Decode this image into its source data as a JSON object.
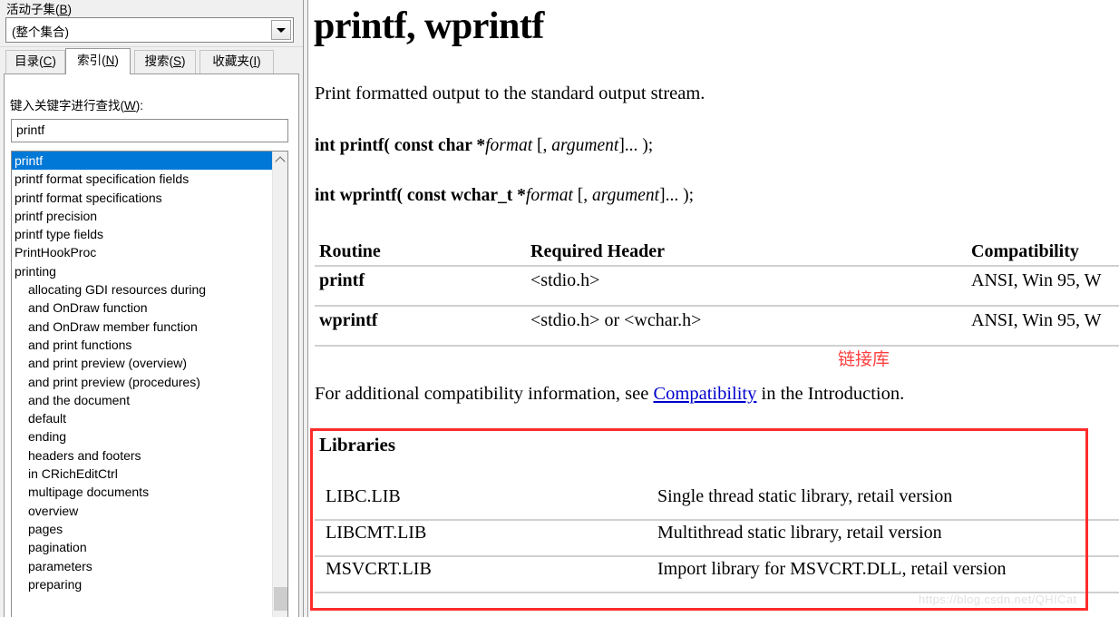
{
  "nav": {
    "subset": {
      "label": "活动子集(B)",
      "label_accel": "B",
      "value": "(整个集合)",
      "dropdown_icon": "chevron-down-icon"
    },
    "tabs": [
      {
        "label": "目录(C)",
        "accel": "C",
        "active": false
      },
      {
        "label": "索引(N)",
        "accel": "N",
        "active": true
      },
      {
        "label": "搜索(S)",
        "accel": "S",
        "active": false
      },
      {
        "label": "收藏夹(I)",
        "accel": "I",
        "active": false
      }
    ],
    "index": {
      "hint": "键入关键字进行查找(W):",
      "hint_accel": "W",
      "keyword_value": "printf",
      "keyword_placeholder": "",
      "selected_index": 0,
      "items": [
        {
          "label": "printf",
          "indent": false
        },
        {
          "label": "printf format specification fields",
          "indent": false
        },
        {
          "label": "printf format specifications",
          "indent": false
        },
        {
          "label": "printf precision",
          "indent": false
        },
        {
          "label": "printf type fields",
          "indent": false
        },
        {
          "label": "PrintHookProc",
          "indent": false
        },
        {
          "label": "printing",
          "indent": false
        },
        {
          "label": "allocating GDI resources during",
          "indent": true
        },
        {
          "label": "and OnDraw function",
          "indent": true
        },
        {
          "label": "and OnDraw member function",
          "indent": true
        },
        {
          "label": "and print functions",
          "indent": true
        },
        {
          "label": "and print preview (overview)",
          "indent": true
        },
        {
          "label": "and print preview (procedures)",
          "indent": true
        },
        {
          "label": "and the document",
          "indent": true
        },
        {
          "label": "default",
          "indent": true
        },
        {
          "label": "ending",
          "indent": true
        },
        {
          "label": "headers and footers",
          "indent": true
        },
        {
          "label": "in CRichEditCtrl",
          "indent": true
        },
        {
          "label": "multipage documents",
          "indent": true
        },
        {
          "label": "overview",
          "indent": true
        },
        {
          "label": "pages",
          "indent": true
        },
        {
          "label": "pagination",
          "indent": true
        },
        {
          "label": "parameters",
          "indent": true
        },
        {
          "label": "preparing",
          "indent": true
        }
      ]
    },
    "scrollbar": {
      "up_arrow_icon": "chevron-up-icon"
    }
  },
  "content": {
    "title": "printf, wprintf",
    "intro": "Print formatted output to the standard output stream.",
    "prototypes": [
      {
        "prefix": "int printf( const char *",
        "italic1": "format",
        "mid": " [, ",
        "italic2": "argument",
        "suffix": "]... );"
      },
      {
        "prefix": "int wprintf( const wchar_t *",
        "italic1": "format",
        "mid": " [, ",
        "italic2": "argument",
        "suffix": "]... );"
      }
    ],
    "compat_table": {
      "headers": [
        "Routine",
        "Required Header",
        "Compatibility"
      ],
      "rows": [
        [
          "printf",
          "<stdio.h>",
          "ANSI, Win 95, W"
        ],
        [
          "wprintf",
          "<stdio.h> or <wchar.h>",
          "ANSI, Win 95, W"
        ]
      ]
    },
    "annotation": {
      "text": "链接库",
      "color": "#ff4040"
    },
    "compat_note": {
      "before": "For additional compatibility information, see ",
      "link": "Compatibility",
      "after": " in the Introduction."
    },
    "libraries": {
      "title": "Libraries",
      "rows": [
        [
          "LIBC.LIB",
          "Single thread static library, retail version"
        ],
        [
          "LIBCMT.LIB",
          "Multithread static library, retail version"
        ],
        [
          "MSVCRT.LIB",
          "Import library for MSVCRT.DLL, retail version"
        ]
      ]
    },
    "highlight_box_color": "#fd2c2c",
    "watermark": "https://blog.csdn.net/QHICat"
  }
}
